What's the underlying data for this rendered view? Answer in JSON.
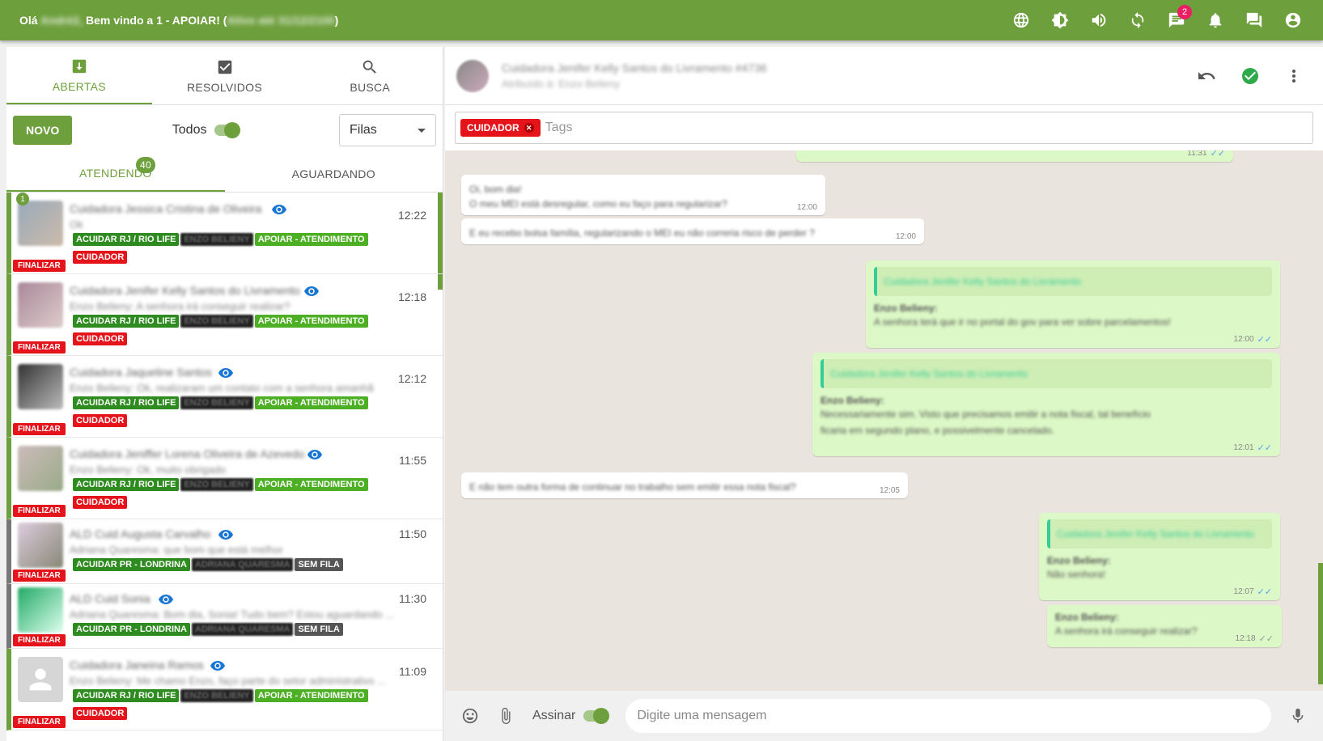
{
  "header": {
    "greeting_prefix": "Olá",
    "greeting_name": "André2,",
    "greeting_middle": "Bem vindo a 1 - APOIAR! (",
    "greeting_status": "Ativo até 31/12/2100",
    "greeting_suffix": ")",
    "notification_count": "2"
  },
  "tabs": [
    {
      "label": "ABERTAS",
      "icon": "inbox-icon"
    },
    {
      "label": "RESOLVIDOS",
      "icon": "check-box-icon"
    },
    {
      "label": "BUSCA",
      "icon": "search-icon"
    }
  ],
  "controls": {
    "new_label": "NOVO",
    "todos_label": "Todos",
    "filas_label": "Filas"
  },
  "subtabs": {
    "atendendo": "ATENDENDO",
    "aguardando": "AGUARDANDO",
    "count": "40"
  },
  "tickets": [
    {
      "name": "Cuidadora Jessica Cristina de Oliveira",
      "msg": "Ok",
      "time": "12:22",
      "unread": "1",
      "queue": "ACUIDAR RJ / RIO LIFE",
      "user": "ENZO BELIENY",
      "status": "APOIAR - ATENDIMENTO",
      "tag": "CUIDADOR",
      "finalize": "FINALIZAR"
    },
    {
      "name": "Cuidadora Jenifer Kelly Santos do Livramento",
      "msg": "Enzo Belieny: A senhora irá conseguir realizar?",
      "time": "12:18",
      "queue": "ACUIDAR RJ / RIO LIFE",
      "user": "ENZO BELIENY",
      "status": "APOIAR - ATENDIMENTO",
      "tag": "CUIDADOR",
      "finalize": "FINALIZAR"
    },
    {
      "name": "Cuidadora Jaqueline Santos",
      "msg": "Enzo Belieny: Ok, realizaram um contato com a senhora amanhã",
      "time": "12:12",
      "queue": "ACUIDAR RJ / RIO LIFE",
      "user": "ENZO BELIENY",
      "status": "APOIAR - ATENDIMENTO",
      "tag": "CUIDADOR",
      "finalize": "FINALIZAR"
    },
    {
      "name": "Cuidadora Jeniffer Lorena Oliveira de Azevedo",
      "msg": "Enzo Belieny: Ok, muito obrigado",
      "time": "11:55",
      "queue": "ACUIDAR RJ / RIO LIFE",
      "user": "ENZO BELIENY",
      "status": "APOIAR - ATENDIMENTO",
      "tag": "CUIDADOR",
      "finalize": "FINALIZAR"
    },
    {
      "name": "ALD Cuid Augusta Carvalho",
      "msg": "Adriana Quaresma: que bom que está melhor",
      "time": "11:50",
      "queue": "ACUIDAR PR - LONDRINA",
      "user": "ADRIANA QUARESMA",
      "status": "SEM FILA",
      "finalize": "FINALIZAR"
    },
    {
      "name": "ALD Cuid Sonia",
      "msg": "Adriana Quaresma: Bom dia, Sonia! Tudo bem? Estou aguardando ...",
      "time": "11:30",
      "queue": "ACUIDAR PR - LONDRINA",
      "user": "ADRIANA QUARESMA",
      "status": "SEM FILA",
      "finalize": "FINALIZAR"
    },
    {
      "name": "Cuidadora Janeina Ramos",
      "msg": "Enzo Belieny: Me chamo Enzo, faço parte do setor administrativo ...",
      "time": "11:09",
      "queue": "ACUIDAR RJ / RIO LIFE",
      "user": "ENZO BELIENY",
      "status": "APOIAR - ATENDIMENTO",
      "tag": "CUIDADOR",
      "finalize": "FINALIZAR"
    }
  ],
  "chat": {
    "contact": "Cuidadora Jenifer Kelly Santos do Livramento #4736",
    "assigned": "Atribuído à: Enzo Belieny",
    "tag_chip": "CUIDADOR",
    "tags_placeholder": "Tags",
    "messages": {
      "m0_time": "11:31",
      "m1_text1": "Oi, bom dia!",
      "m1_text2": "O meu MEI está desregular, como eu faço para regularizar?",
      "m1_time": "12:00",
      "m2_text": "E eu recebo bolsa família, regularizando o MEI eu não correria risco de perder ?",
      "m2_time": "12:00",
      "m3_quote": "Cuidadora Jenifer Kelly Santos do Livramento",
      "m3_sender": "Enzo Belieny:",
      "m3_text": "A senhora terá que ir no portal do gov para ver sobre parcelamentos!",
      "m3_time": "12:00",
      "m4_quote": "Cuidadora Jenifer Kelly Santos do Livramento",
      "m4_sender": "Enzo Belieny:",
      "m4_text1": "Necessariamente sim. Visto que precisamos emitir a nota fiscal, tal benefício",
      "m4_text2": "ficaria em segundo plano, e possivelmente cancelado.",
      "m4_time": "12:01",
      "m5_text": "E não tem outra forma de continuar no trabalho sem emitir essa nota fiscal?",
      "m5_time": "12:05",
      "m6_quote": "Cuidadora Jenifer Kelly Santos do Livramento",
      "m6_sender": "Enzo Belieny:",
      "m6_text": "Não senhora!",
      "m6_time": "12:07",
      "m7_sender": "Enzo Belieny:",
      "m7_text": "A senhora irá conseguir realizar?",
      "m7_time": "12:18"
    }
  },
  "composer": {
    "sign_label": "Assinar",
    "placeholder": "Digite uma mensagem"
  }
}
